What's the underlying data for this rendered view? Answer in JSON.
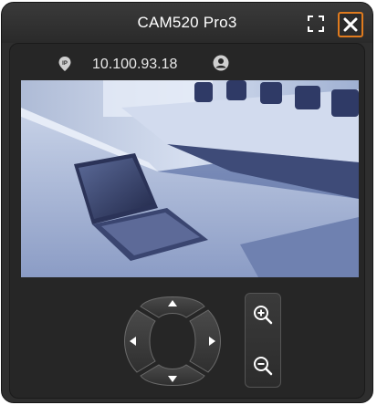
{
  "window": {
    "title": "CAM520 Pro3",
    "fullscreen_icon": "fullscreen-icon",
    "close_icon": "close-icon",
    "close_highlight_color": "#e07b1e"
  },
  "info": {
    "ip_icon": "ip-location-icon",
    "ip_address": "10.100.93.18",
    "user_icon": "user-icon"
  },
  "video": {
    "description_icon": "camera-feed"
  },
  "ptz": {
    "up_icon": "arrow-up-icon",
    "down_icon": "arrow-down-icon",
    "left_icon": "arrow-left-icon",
    "right_icon": "arrow-right-icon",
    "zoom_in_icon": "zoom-in-icon",
    "zoom_out_icon": "zoom-out-icon"
  }
}
